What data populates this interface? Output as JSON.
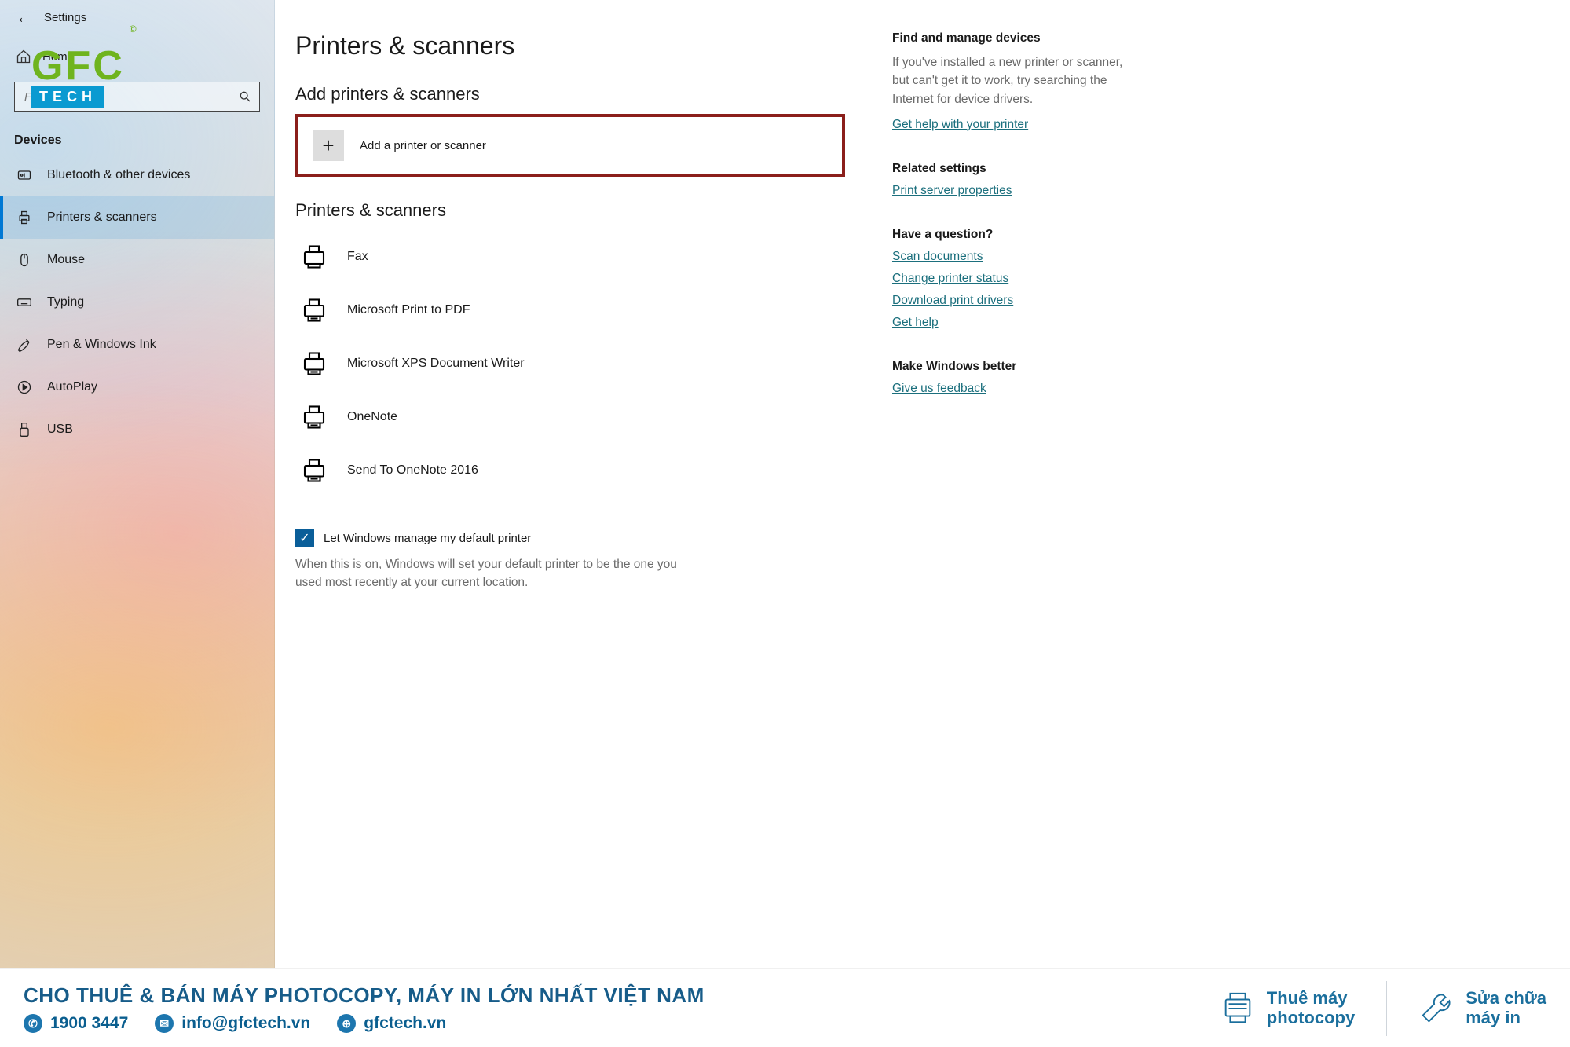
{
  "window": {
    "title": "Settings"
  },
  "sidebar": {
    "home": "Home",
    "search_placeholder": "Find a setting",
    "section": "Devices",
    "items": [
      {
        "id": "bluetooth",
        "label": "Bluetooth & other devices"
      },
      {
        "id": "printers",
        "label": "Printers & scanners",
        "selected": true
      },
      {
        "id": "mouse",
        "label": "Mouse"
      },
      {
        "id": "typing",
        "label": "Typing"
      },
      {
        "id": "pen",
        "label": "Pen & Windows Ink"
      },
      {
        "id": "autoplay",
        "label": "AutoPlay"
      },
      {
        "id": "usb",
        "label": "USB"
      }
    ]
  },
  "page": {
    "title": "Printers & scanners",
    "add_section": "Add printers & scanners",
    "add_button": "Add a printer or scanner",
    "list_section": "Printers & scanners",
    "printers": [
      "Fax",
      "Microsoft Print to PDF",
      "Microsoft XPS Document Writer",
      "OneNote",
      "Send To OneNote 2016"
    ],
    "default_checkbox_label": "Let Windows manage my default printer",
    "default_checkbox_checked": true,
    "default_help": "When this is on, Windows will set your default printer to be the one you used most recently at your current location."
  },
  "right": {
    "find_title": "Find and manage devices",
    "find_text": "If you've installed a new printer or scanner, but can't get it to work, try searching the Internet for device drivers.",
    "find_link": "Get help with your printer",
    "related_title": "Related settings",
    "related_link": "Print server properties",
    "question_title": "Have a question?",
    "question_links": [
      "Scan documents",
      "Change printer status",
      "Download print drivers",
      "Get help"
    ],
    "better_title": "Make Windows better",
    "better_link": "Give us feedback"
  },
  "logo": {
    "top": "GFC",
    "bottom": "TECH"
  },
  "footer": {
    "headline": "CHO THUÊ & BÁN MÁY PHOTOCOPY, MÁY IN LỚN NHẤT VIỆT NAM",
    "phone": "1900 3447",
    "email": "info@gfctech.vn",
    "site": "gfctech.vn",
    "svc1_l1": "Thuê máy",
    "svc1_l2": "photocopy",
    "svc2_l1": "Sửa chữa",
    "svc2_l2": "máy in"
  }
}
